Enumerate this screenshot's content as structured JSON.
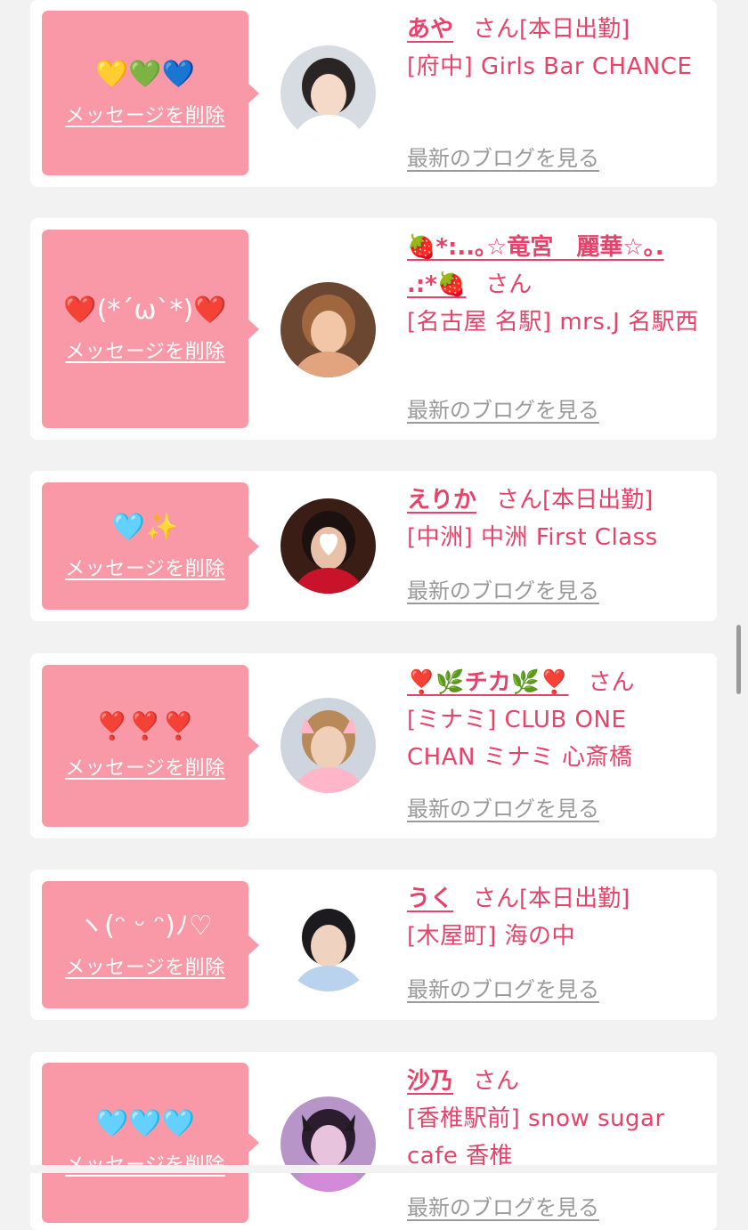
{
  "colors": {
    "page_bg": "#f2f2f2",
    "card_bg": "#ffffff",
    "bubble_bg": "#f998a6",
    "accent": "#e6436b",
    "blog_link": "#9a9a9a"
  },
  "delete_label": "メッセージを削除",
  "san_label": "さん",
  "blog_label": "最新のブログを見る",
  "messages": [
    {
      "emoji": "💛💚💙",
      "name_parts": [
        "あや"
      ],
      "status": "[本日出勤]",
      "shop": "[府中] Girls Bar CHANCE",
      "avatar_icon": "girl-portrait-avatar"
    },
    {
      "emoji": "❤️(*´ω`*)❤️",
      "name_parts": [
        "🍓*:..｡☆竜宮　麗華☆｡.",
        ".:*🍓"
      ],
      "status": "",
      "shop": "[名古屋 名駅] mrs.J 名駅西",
      "avatar_icon": "selfie-avatar"
    },
    {
      "emoji": "🩵✨",
      "name_parts": [
        "えりか"
      ],
      "status": "[本日出勤]",
      "shop": "[中洲] 中洲 First Class",
      "avatar_icon": "heart-covered-avatar"
    },
    {
      "emoji": "❣️❣️❣️",
      "name_parts": [
        "❣️🌿チカ🌿❣️"
      ],
      "status": "",
      "shop": "[ミナミ] CLUB ONE CHAN ミナミ 心斎橋",
      "avatar_icon": "cat-filter-avatar"
    },
    {
      "emoji": "ヽ(ᵔ ᵕ ᵔ)ﾉ♡",
      "name_parts": [
        "うく"
      ],
      "status": "[本日出勤]",
      "shop": "[木屋町] 海の中",
      "avatar_icon": "cutout-avatar"
    },
    {
      "emoji": "🩵🩵🩵",
      "name_parts": [
        "沙乃"
      ],
      "status": "",
      "shop": "[香椎駅前] snow sugar cafe 香椎",
      "avatar_icon": "devil-horns-avatar"
    }
  ]
}
